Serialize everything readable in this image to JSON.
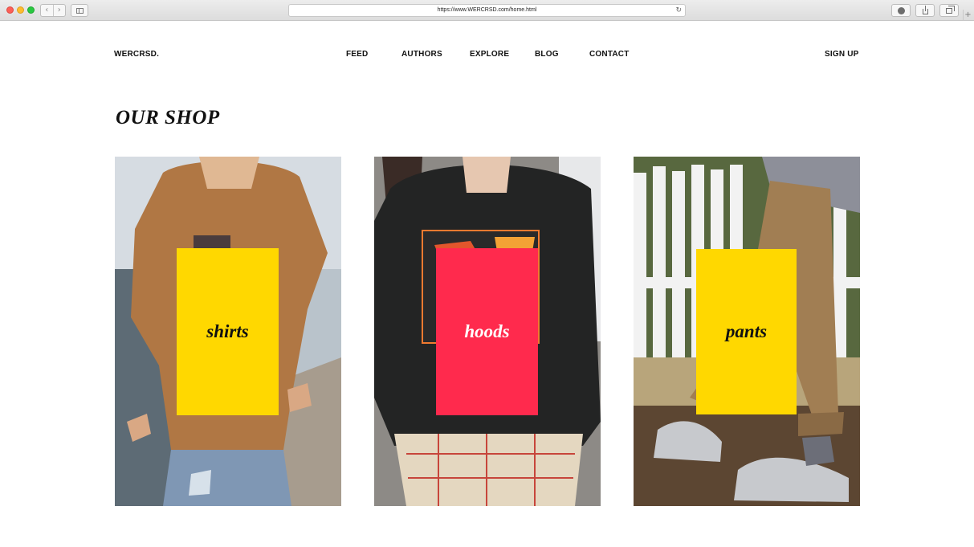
{
  "browser": {
    "url": "https://www.WERCRSD.com/home.html",
    "back_glyph": "‹",
    "forward_glyph": "›",
    "reload_glyph": "↻",
    "new_tab_glyph": "+"
  },
  "header": {
    "logo": "WERCRSD.",
    "nav": [
      "FEED",
      "AUTHORS",
      "EXPLORE",
      "BLOG",
      "CONTACT"
    ],
    "signup": "SIGN UP"
  },
  "shop": {
    "title": "OUR SHOP",
    "categories": [
      {
        "label": "shirts",
        "box_color": "#ffd800",
        "text_color": "#111111"
      },
      {
        "label": "hoods",
        "box_color": "#ff2a4d",
        "text_color": "#ffffff"
      },
      {
        "label": "pants",
        "box_color": "#ffd800",
        "text_color": "#111111"
      }
    ]
  }
}
